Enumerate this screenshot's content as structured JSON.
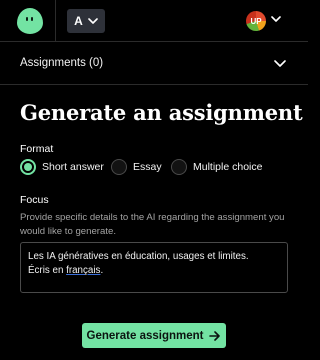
{
  "header": {
    "language_label": "A",
    "avatar_initials": "UP"
  },
  "assignments_bar": {
    "label": "Assignments (0)"
  },
  "main": {
    "title": "Generate an assignment",
    "format": {
      "label": "Format",
      "options": [
        "Short answer",
        "Essay",
        "Multiple choice"
      ],
      "selected": "Short answer"
    },
    "focus": {
      "label": "Focus",
      "help": "Provide specific details to the AI regarding the assignment you would like to generate.",
      "line1": "Les IA génératives en éducation, usages et limites.",
      "line2_prefix": "Écris en ",
      "line2_word": "français",
      "line2_suffix": "."
    },
    "generate_label": "Generate assignment",
    "generate_icon": "arrow-right-icon"
  },
  "colors": {
    "accent": "#73e3a3",
    "background": "#000000",
    "muted_text": "#a3a3a3"
  }
}
